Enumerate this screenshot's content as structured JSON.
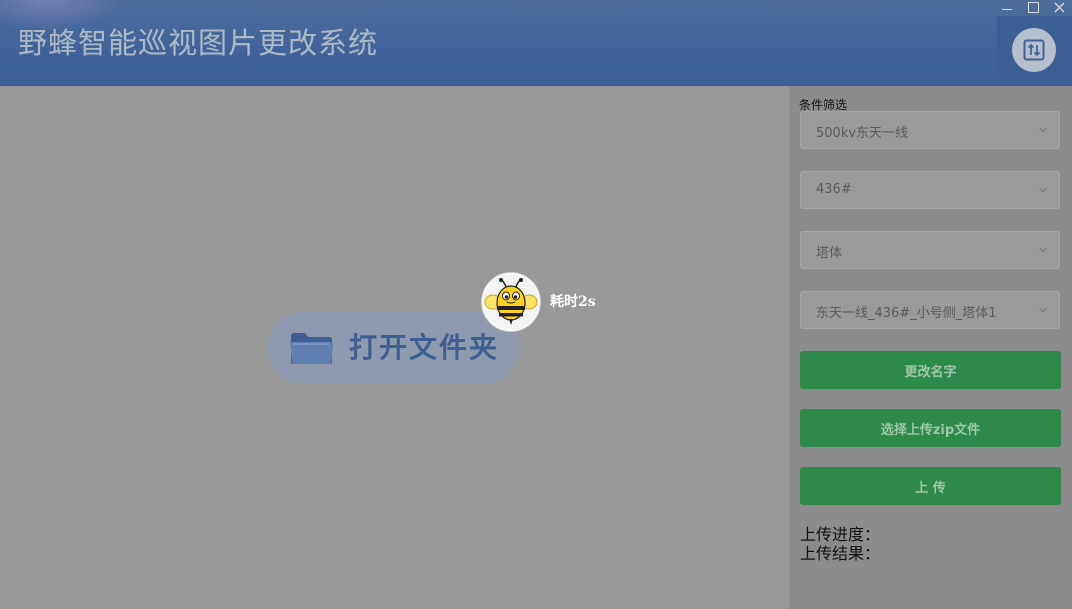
{
  "window": {
    "title": "野蜂智能巡视图片更改系统",
    "controls": {
      "minimize_icon": "minimize-icon",
      "maximize_icon": "maximize-icon",
      "close_icon": "close-icon"
    },
    "upload_tile_icon": "upload-sort-icon"
  },
  "main": {
    "open_folder_label": "打开文件夹",
    "folder_icon": "folder-icon",
    "bee_icon": "bee-mascot-icon",
    "elapsed_label": "耗时2s"
  },
  "panel": {
    "filter_title": "条件筛选",
    "selects": [
      {
        "value": "500kv东天一线"
      },
      {
        "value": "436#"
      },
      {
        "value": "塔体"
      },
      {
        "value": "东天一线_436#_小号侧_塔体1"
      }
    ],
    "rename_button": "更改名字",
    "choose_zip_button": "选择上传zip文件",
    "upload_button": "上 传",
    "progress_label": "上传进度：",
    "result_label": "上传结果："
  },
  "colors": {
    "header": "#3f6399",
    "overlay_gray": "#999999",
    "panel": "#8c8c8c",
    "green": "#2e8a4b",
    "folder_pill": "#8e9aae"
  }
}
